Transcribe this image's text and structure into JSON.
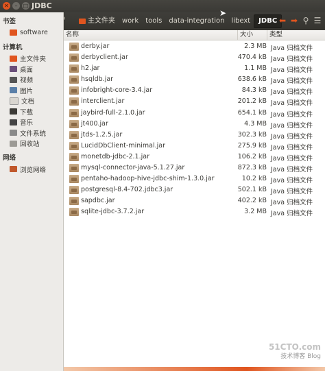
{
  "window": {
    "title": "JDBC"
  },
  "breadcrumb": [
    "主文件夹",
    "work",
    "tools",
    "data-integration",
    "libext",
    "JDBC"
  ],
  "sidebar": {
    "bookmarks_header": "书签",
    "bookmarks": [
      {
        "label": "software",
        "icon": "folder-icon"
      }
    ],
    "computer_header": "计算机",
    "computer": [
      {
        "label": "主文件夹",
        "icon": "home-icon"
      },
      {
        "label": "桌面",
        "icon": "desktop-icon"
      },
      {
        "label": "视频",
        "icon": "video-icon"
      },
      {
        "label": "图片",
        "icon": "picture-icon"
      },
      {
        "label": "文档",
        "icon": "document-icon"
      },
      {
        "label": "下载",
        "icon": "download-icon"
      },
      {
        "label": "音乐",
        "icon": "music-icon"
      },
      {
        "label": "文件系统",
        "icon": "drive-icon"
      },
      {
        "label": "回收站",
        "icon": "trash-icon"
      }
    ],
    "network_header": "网络",
    "network": [
      {
        "label": "浏览网络",
        "icon": "network-icon"
      }
    ]
  },
  "columns": {
    "name": "名称",
    "size": "大小",
    "type": "类型"
  },
  "files": [
    {
      "name": "derby.jar",
      "size": "2.3 MB",
      "type": "Java 归档文件"
    },
    {
      "name": "derbyclient.jar",
      "size": "470.4 kB",
      "type": "Java 归档文件"
    },
    {
      "name": "h2.jar",
      "size": "1.1 MB",
      "type": "Java 归档文件"
    },
    {
      "name": "hsqldb.jar",
      "size": "638.6 kB",
      "type": "Java 归档文件"
    },
    {
      "name": "infobright-core-3.4.jar",
      "size": "84.3 kB",
      "type": "Java 归档文件"
    },
    {
      "name": "interclient.jar",
      "size": "201.2 kB",
      "type": "Java 归档文件"
    },
    {
      "name": "jaybird-full-2.1.0.jar",
      "size": "654.1 kB",
      "type": "Java 归档文件"
    },
    {
      "name": "jt400.jar",
      "size": "4.3 MB",
      "type": "Java 归档文件"
    },
    {
      "name": "jtds-1.2.5.jar",
      "size": "302.3 kB",
      "type": "Java 归档文件"
    },
    {
      "name": "LucidDbClient-minimal.jar",
      "size": "275.9 kB",
      "type": "Java 归档文件"
    },
    {
      "name": "monetdb-jdbc-2.1.jar",
      "size": "106.2 kB",
      "type": "Java 归档文件"
    },
    {
      "name": "mysql-connector-java-5.1.27.jar",
      "size": "872.3 kB",
      "type": "Java 归档文件"
    },
    {
      "name": "pentaho-hadoop-hive-jdbc-shim-1.3.0.jar",
      "size": "10.2 kB",
      "type": "Java 归档文件"
    },
    {
      "name": "postgresql-8.4-702.jdbc3.jar",
      "size": "502.1 kB",
      "type": "Java 归档文件"
    },
    {
      "name": "sapdbc.jar",
      "size": "402.2 kB",
      "type": "Java 归档文件"
    },
    {
      "name": "sqlite-jdbc-3.7.2.jar",
      "size": "3.2 MB",
      "type": "Java 归档文件"
    }
  ],
  "watermark": {
    "site": "51CTO.com",
    "sub": "技术博客",
    "tag": "Blog"
  },
  "colors": {
    "accent": "#e0551f",
    "titlebar": "#3c3b37",
    "sidebar": "#edebe8"
  }
}
